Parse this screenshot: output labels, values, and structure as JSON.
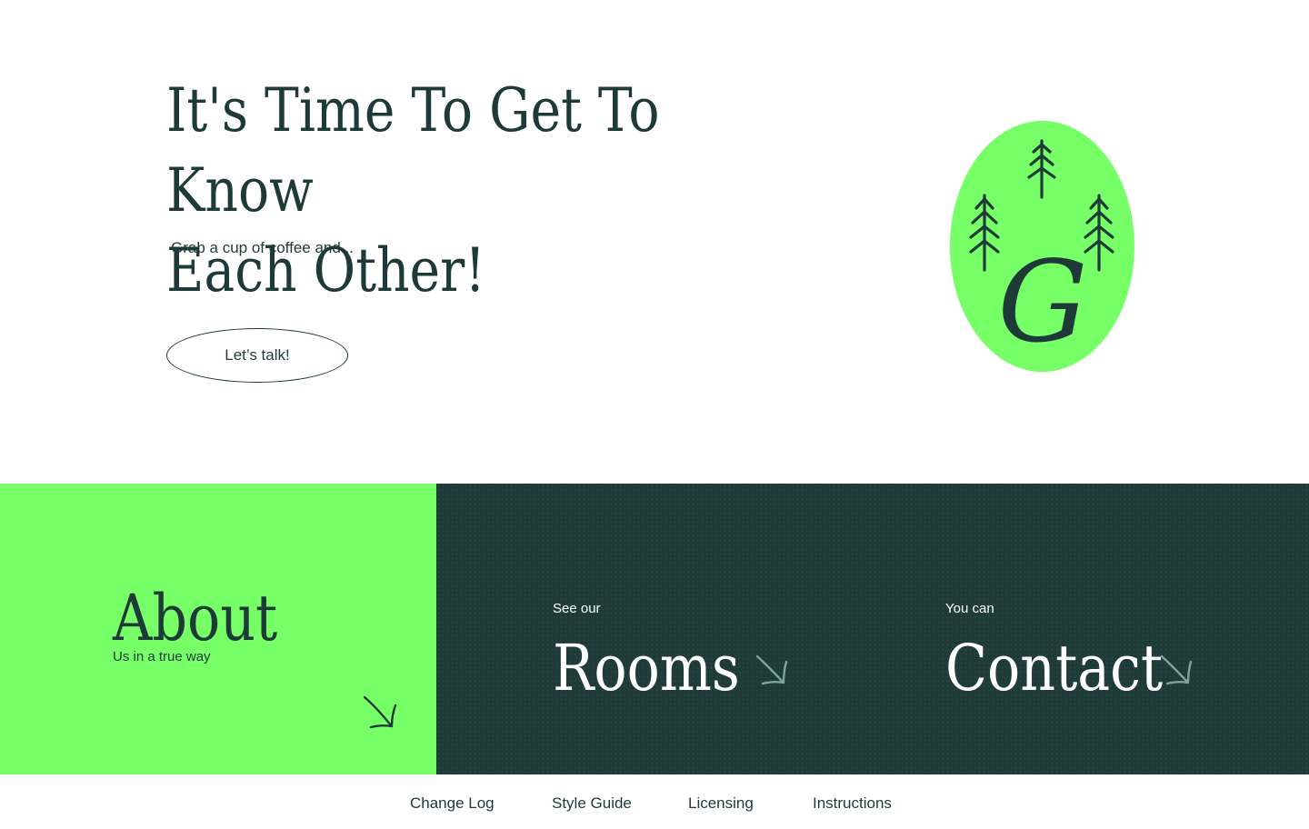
{
  "hero": {
    "title_line1": "It's Time To Get To Know",
    "title_line2": "Each Other!",
    "subtitle": "Grab a cup of coffee and...",
    "cta_label": "Let’s talk!"
  },
  "badge": {
    "letter": "G",
    "icon": "pine-trees-icon",
    "color": "#76ff66"
  },
  "tiles": {
    "about": {
      "title": "About",
      "subtitle": "Us in a true way",
      "icon": "arrow-down-right-icon"
    },
    "rooms": {
      "eyebrow": "See our",
      "title": "Rooms",
      "icon": "arrow-down-right-icon"
    },
    "contact": {
      "eyebrow": "You can",
      "title": "Contact",
      "icon": "arrow-down-right-icon"
    }
  },
  "footer": {
    "links": [
      "Change Log",
      "Style Guide",
      "Licensing",
      "Instructions"
    ]
  },
  "colors": {
    "accent_green": "#76ff66",
    "dark_green": "#1f3b39",
    "text": "#1e3a38"
  }
}
